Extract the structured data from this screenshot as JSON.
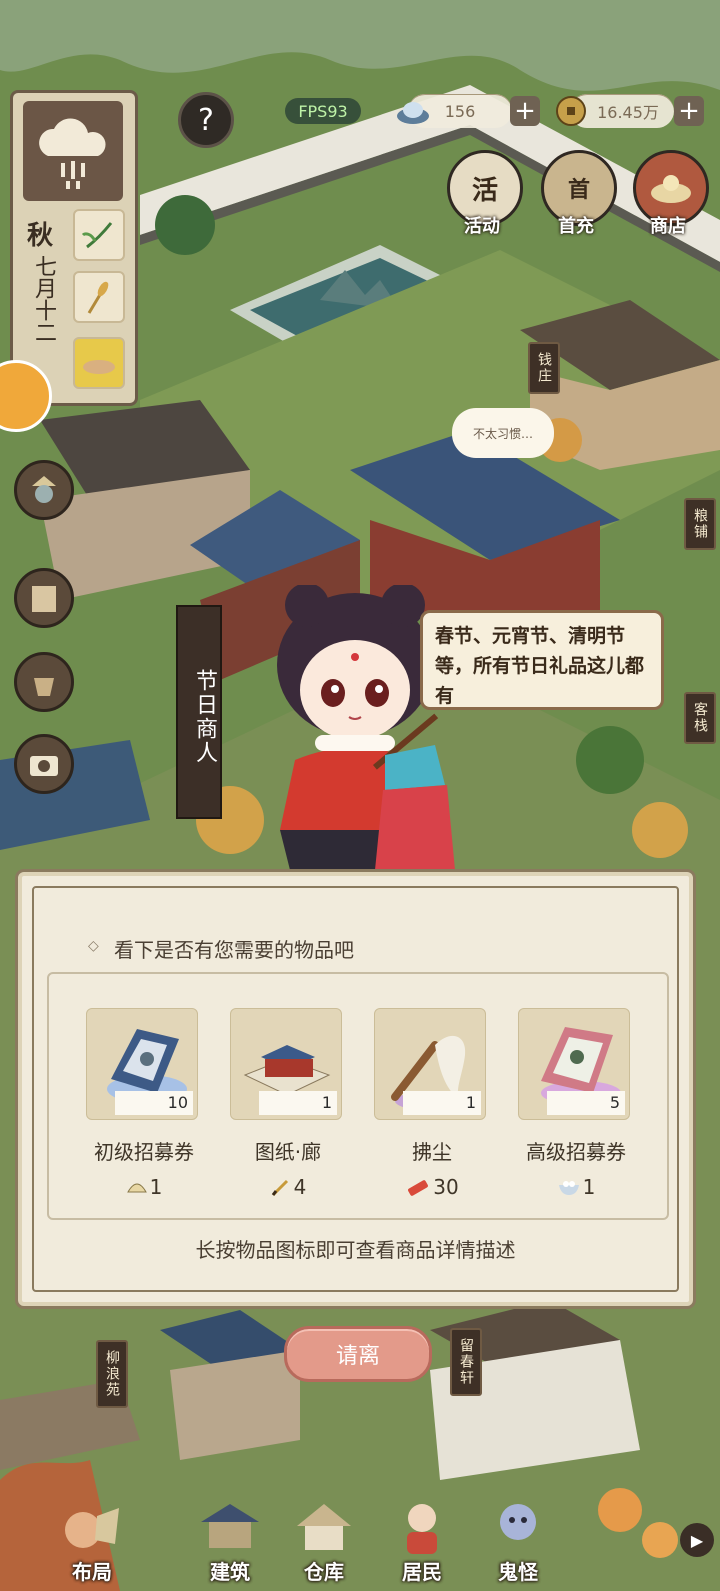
{
  "hud": {
    "fps": "FPS93",
    "silver": "156",
    "copper": "16.45万",
    "help": "?"
  },
  "top_menu": [
    {
      "label": "活动",
      "icon": "scroll-icon",
      "glyph": "活"
    },
    {
      "label": "首充",
      "icon": "gift-bag-icon",
      "glyph": "首"
    },
    {
      "label": "商店",
      "icon": "treasure-icon",
      "glyph": ""
    }
  ],
  "calendar": {
    "season": "秋",
    "date": "七月十二"
  },
  "signs": {
    "qianzhuang": "钱庄",
    "liangpu": "粮铺",
    "kezhan": "客栈",
    "liulangyuan": "柳浪苑",
    "liuchunxuan": "留春轩"
  },
  "npc": {
    "sign": "节日商人",
    "speech": "春节、元宵节、清明节等，所有节日礼品这儿都有",
    "thought": "不太习惯…"
  },
  "shop": {
    "prompt": "看下是否有您需要的物品吧",
    "hint": "长按物品图标即可查看商品详情描述",
    "items": [
      {
        "name": "初级招募券",
        "count": "10",
        "price": "1",
        "price_icon": "dumpling-icon",
        "icon": "book-blue-icon"
      },
      {
        "name": "图纸·廊",
        "count": "1",
        "price": "4",
        "price_icon": "brush-icon",
        "icon": "blueprint-icon"
      },
      {
        "name": "拂尘",
        "count": "1",
        "price": "30",
        "price_icon": "firecracker-icon",
        "icon": "whisk-icon"
      },
      {
        "name": "高级招募券",
        "count": "5",
        "price": "1",
        "price_icon": "tangyuan-bowl-icon",
        "icon": "book-pink-icon"
      }
    ],
    "leave": "请离"
  },
  "bottom_nav": [
    {
      "label": "布局",
      "icon": "layout-icon"
    },
    {
      "label": "建筑",
      "icon": "building-icon"
    },
    {
      "label": "仓库",
      "icon": "warehouse-icon"
    },
    {
      "label": "居民",
      "icon": "resident-icon"
    },
    {
      "label": "鬼怪",
      "icon": "ghost-icon"
    }
  ],
  "colors": {
    "grass": "#6f8d4e",
    "panel": "#f1ebdc",
    "leave_button": "#e39a8a",
    "sign_dark": "#3c2f27"
  }
}
